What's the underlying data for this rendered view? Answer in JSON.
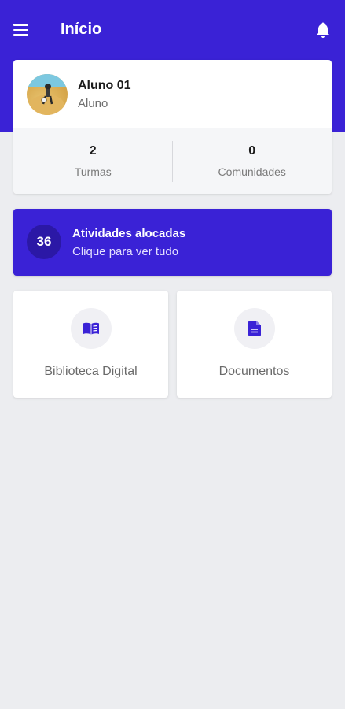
{
  "colors": {
    "primary": "#3A22D6",
    "primary_dark": "#2B18A6",
    "background": "#ECEDF0"
  },
  "appbar": {
    "title": "Início",
    "menu_icon": "menu-icon",
    "notification_icon": "bell-icon"
  },
  "profile": {
    "name": "Aluno 01",
    "role": "Aluno",
    "stats": [
      {
        "value": "2",
        "label": "Turmas"
      },
      {
        "value": "0",
        "label": "Comunidades"
      }
    ]
  },
  "activities": {
    "count": "36",
    "title": "Atividades alocadas",
    "subtitle": "Clique para ver tudo"
  },
  "tiles": [
    {
      "label": "Biblioteca Digital",
      "icon": "book-icon"
    },
    {
      "label": "Documentos",
      "icon": "document-icon"
    }
  ]
}
